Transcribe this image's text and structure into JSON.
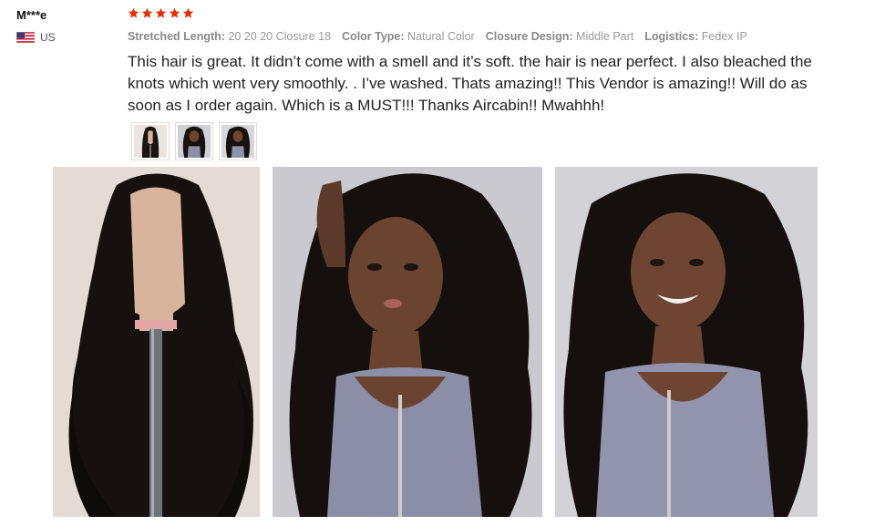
{
  "buyer": {
    "name": "M***e",
    "country": "US"
  },
  "rating": {
    "stars": 5,
    "max": 5,
    "color": "#e62e04"
  },
  "attributes": [
    {
      "name": "Stretched Length:",
      "value": "20 20 20 Closure 18"
    },
    {
      "name": "Color Type:",
      "value": "Natural Color"
    },
    {
      "name": "Closure Design:",
      "value": "Middle Part"
    },
    {
      "name": "Logistics:",
      "value": "Fedex IP"
    }
  ],
  "review_text": "This hair is great. It didn’t come with a smell and it’s soft. the hair is near perfect. I also bleached the knots which went very smoothly. . I’ve washed.  Thats amazing!! This Vendor is amazing!! Will do as soon as I order again. Which is a MUST!!! Thanks Aircabin!! Mwahhh!",
  "thumbnails": [
    {
      "icon": "wig-on-mannequin-thumbnail"
    },
    {
      "icon": "model-wearing-wig-thumbnail"
    },
    {
      "icon": "model-smiling-thumbnail"
    }
  ],
  "photos": [
    {
      "icon": "wig-on-mannequin-photo"
    },
    {
      "icon": "model-wearing-wig-photo"
    },
    {
      "icon": "model-smiling-photo"
    }
  ]
}
